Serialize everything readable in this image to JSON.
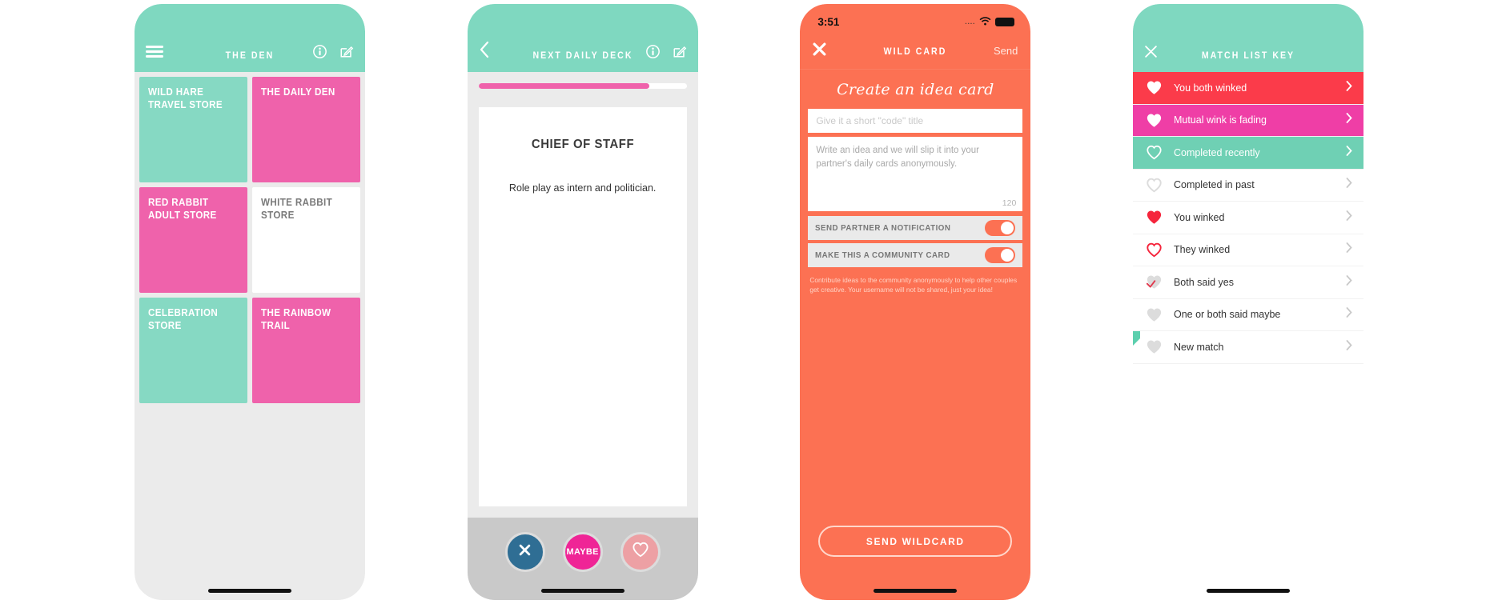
{
  "phone_den": {
    "navbar": {
      "menu_icon": "hamburger-menu-icon",
      "title": "THE DEN",
      "info_icon": "info-icon",
      "compose_icon": "compose-icon"
    },
    "tiles": [
      {
        "label": "WILD HARE\nTRAVEL STORE",
        "style": "mint"
      },
      {
        "label": "THE DAILY DEN",
        "style": "pink"
      },
      {
        "label": "RED RABBIT\nADULT STORE",
        "style": "pink"
      },
      {
        "label": "WHITE RABBIT STORE",
        "style": "white"
      },
      {
        "label": "CELEBRATION STORE",
        "style": "mint"
      },
      {
        "label": "THE RAINBOW TRAIL",
        "style": "pink"
      }
    ]
  },
  "phone_deck": {
    "navbar": {
      "back_icon": "chevron-left-icon",
      "title": "NEXT DAILY DECK",
      "info_icon": "info-icon",
      "compose_icon": "compose-icon"
    },
    "progress_percent": 82,
    "card": {
      "title": "CHIEF OF STAFF",
      "subtitle": "Role play as intern and politician."
    },
    "actions": {
      "no_icon": "close-x-icon",
      "maybe_label": "MAYBE",
      "yes_icon": "heart-outline-icon"
    }
  },
  "phone_wildcard": {
    "statusbar": {
      "time": "3:51",
      "signal_icon": "signal-dots-icon",
      "wifi_icon": "wifi-icon",
      "battery_icon": "battery-icon"
    },
    "navbar": {
      "close_icon": "close-x-icon",
      "title": "WILD CARD",
      "send_label": "Send"
    },
    "heading": "Create an idea card",
    "title_input_placeholder": "Give it a short \"code\" title",
    "idea_textarea_placeholder": "Write an idea and we will slip it into your partner's daily cards anonymously.",
    "char_counter": "120",
    "toggles": [
      {
        "label": "SEND PARTNER A NOTIFICATION",
        "on": true
      },
      {
        "label": "MAKE THIS A COMMUNITY CARD",
        "on": true
      }
    ],
    "note": "Contribute ideas to the community anonymously to help other couples get creative. Your username will not be shared, just your idea!",
    "send_button_label": "SEND WILDCARD",
    "accent_color": "#fc7153"
  },
  "phone_matchkey": {
    "navbar": {
      "close_icon": "close-x-icon",
      "title": "MATCH LIST KEY"
    },
    "rows": [
      {
        "label": "You both winked",
        "row_style": "red",
        "heart": "heart-filled-white",
        "chevron": true,
        "new_flag": false
      },
      {
        "label": "Mutual wink is fading",
        "row_style": "pink",
        "heart": "heart-filled-white",
        "chevron": true,
        "new_flag": false
      },
      {
        "label": "Completed recently",
        "row_style": "mint",
        "heart": "heart-outline-white",
        "chevron": true,
        "new_flag": false
      },
      {
        "label": "Completed in past",
        "row_style": "white",
        "heart": "heart-outline-grey",
        "chevron": true,
        "new_flag": false
      },
      {
        "label": "You winked",
        "row_style": "white",
        "heart": "heart-filled-red",
        "chevron": true,
        "new_flag": false
      },
      {
        "label": "They winked",
        "row_style": "white",
        "heart": "heart-outline-red",
        "chevron": true,
        "new_flag": false
      },
      {
        "label": "Both said yes",
        "row_style": "white",
        "heart": "heart-grey-check",
        "chevron": true,
        "new_flag": false
      },
      {
        "label": "One or both said maybe",
        "row_style": "white",
        "heart": "heart-filled-grey",
        "chevron": true,
        "new_flag": false
      },
      {
        "label": "New match",
        "row_style": "white",
        "heart": "heart-filled-grey",
        "chevron": true,
        "new_flag": true
      }
    ]
  },
  "colors": {
    "mint": "#7fd8c0",
    "pink": "#ef62ab",
    "coral": "#fc7153",
    "red": "#fb3b4a",
    "grey_bg": "#ebebeb"
  }
}
